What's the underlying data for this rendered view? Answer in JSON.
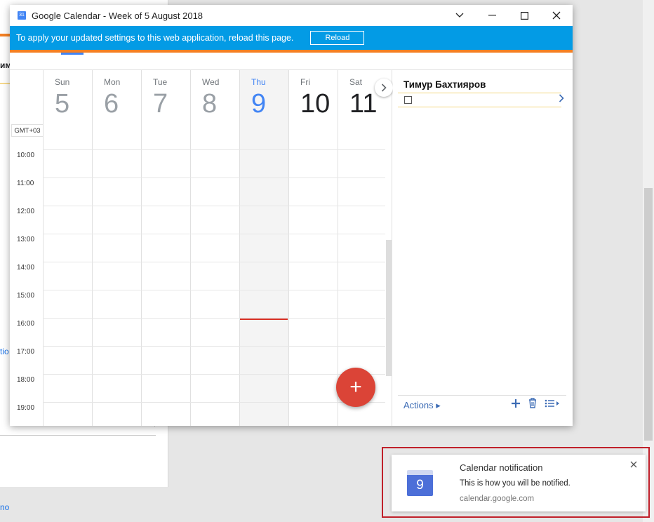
{
  "background": {
    "name_fragment": "иму",
    "side_link": "tio",
    "bottom_link": "no"
  },
  "window": {
    "title": "Google Calendar - Week of 5 August 2018",
    "icon_text": "31"
  },
  "banner": {
    "message": "To apply your updated settings to this web application, reload this page.",
    "reload_label": "Reload"
  },
  "calendar": {
    "days": [
      {
        "name": "Sun",
        "num": "5"
      },
      {
        "name": "Mon",
        "num": "6"
      },
      {
        "name": "Tue",
        "num": "7"
      },
      {
        "name": "Wed",
        "num": "8"
      },
      {
        "name": "Thu",
        "num": "9"
      },
      {
        "name": "Fri",
        "num": "10"
      },
      {
        "name": "Sat",
        "num": "11"
      }
    ],
    "timezone": "GMT+03",
    "hours": [
      "10:00",
      "11:00",
      "12:00",
      "13:00",
      "14:00",
      "15:00",
      "16:00",
      "17:00",
      "18:00",
      "19:00"
    ],
    "fab_label": "+"
  },
  "tasks": {
    "owner": "Тимур Бахтияров",
    "actions_label": "Actions ▸"
  },
  "notification": {
    "title": "Calendar notification",
    "message": "This is how you will be notified.",
    "source": "calendar.google.com",
    "icon_day": "9"
  },
  "colors": {
    "banner": "#039be5",
    "accent_orange": "#f48024",
    "today_blue": "#4285f4",
    "fab_red": "#db4437",
    "highlight_frame": "#c0202a"
  }
}
